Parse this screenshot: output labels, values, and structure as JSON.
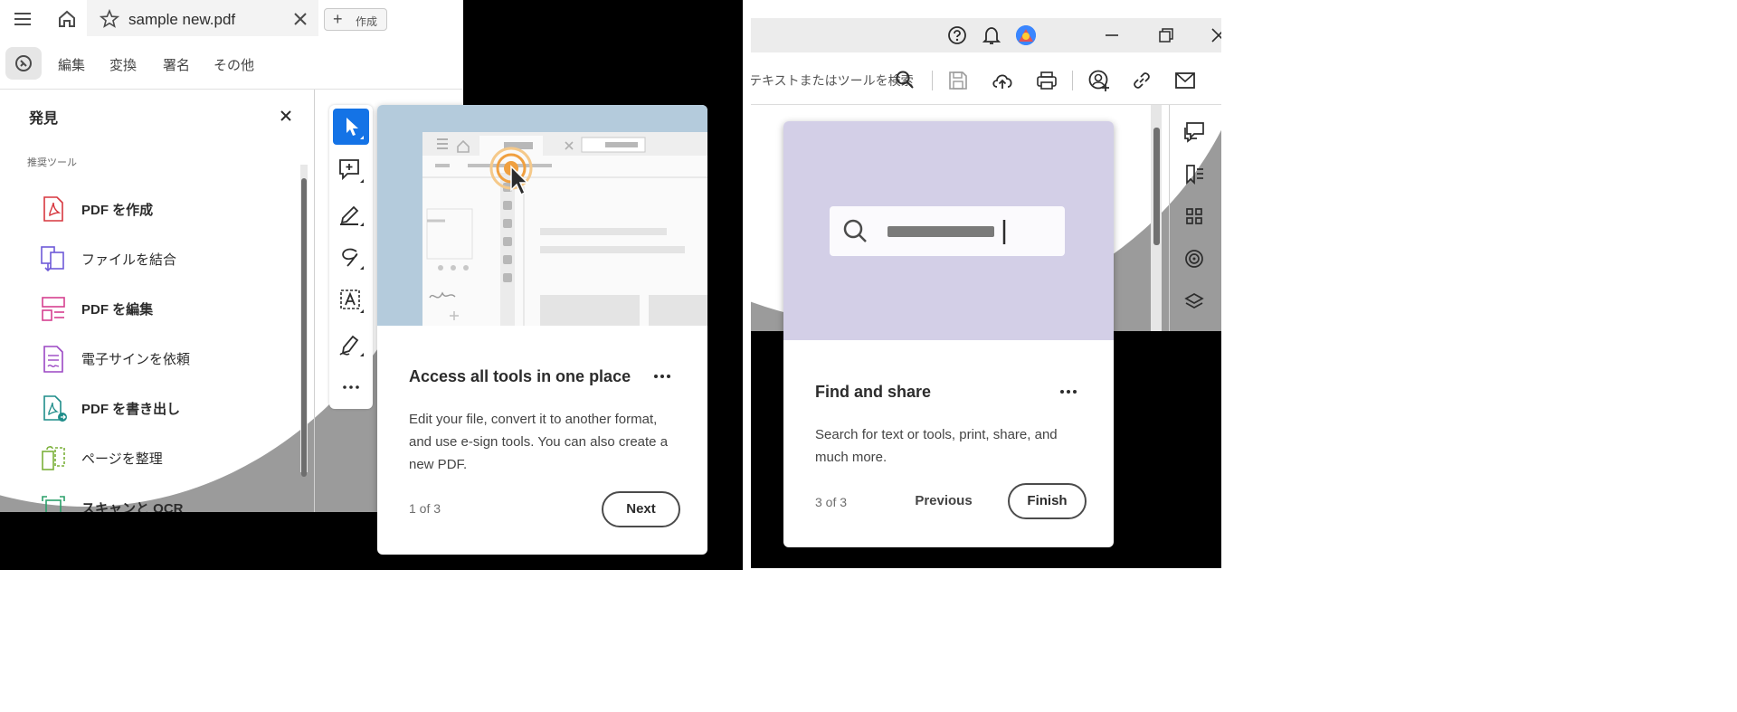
{
  "left": {
    "tab": {
      "title": "sample new.pdf"
    },
    "new_button": {
      "label": "作成"
    },
    "menu": [
      "編集",
      "変換",
      "署名",
      "その他"
    ],
    "panel_title": "発見",
    "section_label": "推奨ツール",
    "tools": [
      {
        "label": "PDF を作成",
        "color": "#d7373f"
      },
      {
        "label": "ファイルを結合",
        "color": "#6e5ad8"
      },
      {
        "label": "PDF を編集",
        "color": "#d5408f"
      },
      {
        "label": "電子サインを依頼",
        "color": "#9b47c4"
      },
      {
        "label": "PDF を書き出し",
        "color": "#1f8d8a"
      },
      {
        "label": "ページを整理",
        "color": "#7bb03a"
      },
      {
        "label": "スキャンと OCR",
        "color": "#2ba06a"
      }
    ],
    "card": {
      "title": "Access all tools in one place",
      "body": "Edit your file, convert it to another format, and use e-sign tools. You can also create a new PDF.",
      "step": "1 of 3",
      "next_label": "Next",
      "illustration_bg": "#b4cbdc"
    }
  },
  "right": {
    "search_placeholder": "テキストまたはツールを検索",
    "card": {
      "title": "Find and share",
      "body": "Search for text or tools, print, share, and much more.",
      "step": "3 of 3",
      "previous_label": "Previous",
      "finish_label": "Finish",
      "illustration_bg": "#d3cfe7"
    }
  },
  "colors": {
    "accent": "#1473e6",
    "page_bg": "#9b9b9b"
  }
}
